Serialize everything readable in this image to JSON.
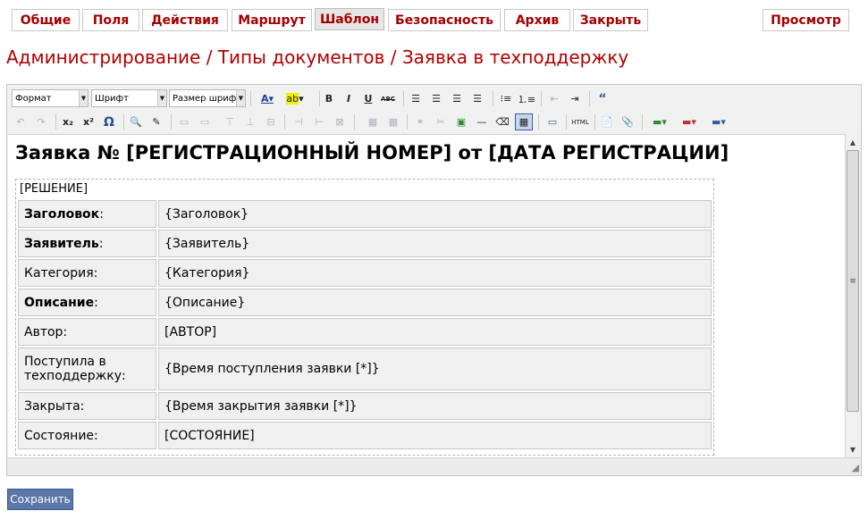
{
  "tabs": [
    {
      "label": "Общие",
      "active": false
    },
    {
      "label": "Поля",
      "active": false
    },
    {
      "label": "Действия",
      "active": false
    },
    {
      "label": "Маршрут",
      "active": false
    },
    {
      "label": "Шаблон",
      "active": true
    },
    {
      "label": "Безопасность",
      "active": false
    },
    {
      "label": "Архив",
      "active": false
    },
    {
      "label": "Закрыть",
      "active": false
    },
    {
      "label": "Просмотр",
      "active": false
    }
  ],
  "breadcrumb": "Администрирование / Типы документов / Заявка в техподдержку",
  "toolbar": {
    "format": "Формат",
    "font": "Шрифт",
    "size": "Размер шрифт",
    "bold": "B",
    "italic": "I",
    "underline": "U",
    "strike": "ABC",
    "subscript": "x₂",
    "superscript": "x²",
    "omega": "Ω",
    "html": "HTML"
  },
  "document": {
    "heading": "Заявка № [РЕГИСТРАЦИОННЫЙ НОМЕР] от [ДАТА РЕГИСТРАЦИИ]",
    "decision": "[РЕШЕНИЕ]",
    "rows": [
      {
        "key": "Заголовок",
        "colon": ":",
        "value": "{Заголовок}",
        "bold": true
      },
      {
        "key": "Заявитель",
        "colon": ":",
        "value": "{Заявитель}",
        "bold": true
      },
      {
        "key": "Категория:",
        "colon": "",
        "value": "{Категория}",
        "bold": false
      },
      {
        "key": "Описание",
        "colon": ":",
        "value": "{Описание}",
        "bold": true
      },
      {
        "key": "Автор:",
        "colon": "",
        "value": "[АВТОР]",
        "bold": false
      },
      {
        "key": "Поступила в техподдержку:",
        "colon": "",
        "value": "{Время поступления заявки [*]}",
        "bold": false
      },
      {
        "key": "Закрыта:",
        "colon": "",
        "value": "{Время закрытия заявки [*]}",
        "bold": false
      },
      {
        "key": "Состояние:",
        "colon": "",
        "value": "[СОСТОЯНИЕ]",
        "bold": false
      }
    ]
  },
  "save_label": "Сохранить",
  "colors": {
    "accent": "#a50000",
    "button": "#5b77a8"
  }
}
